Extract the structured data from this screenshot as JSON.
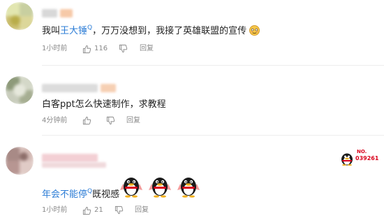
{
  "comments": [
    {
      "text_prefix": "我叫",
      "link_text": "王大锤",
      "link_sup": "Q",
      "text_suffix": "，万万没想到，我接了英雄联盟的宣传",
      "time": "1小时前",
      "likes": "116",
      "reply_label": "回复"
    },
    {
      "text": "白客ppt怎么快速制作，求教程",
      "time": "4分钟前",
      "reply_label": "回复"
    },
    {
      "link_text": "年会不能停",
      "link_sup": "Q",
      "text_suffix": "既视感",
      "time": "1小时前",
      "likes": "21",
      "reply_label": "回复",
      "badge": {
        "label": "NO.",
        "number": "039261"
      }
    }
  ],
  "colors": {
    "link": "#2b7cd6",
    "meta": "#8a8a8a",
    "badge": "#d9001b"
  }
}
